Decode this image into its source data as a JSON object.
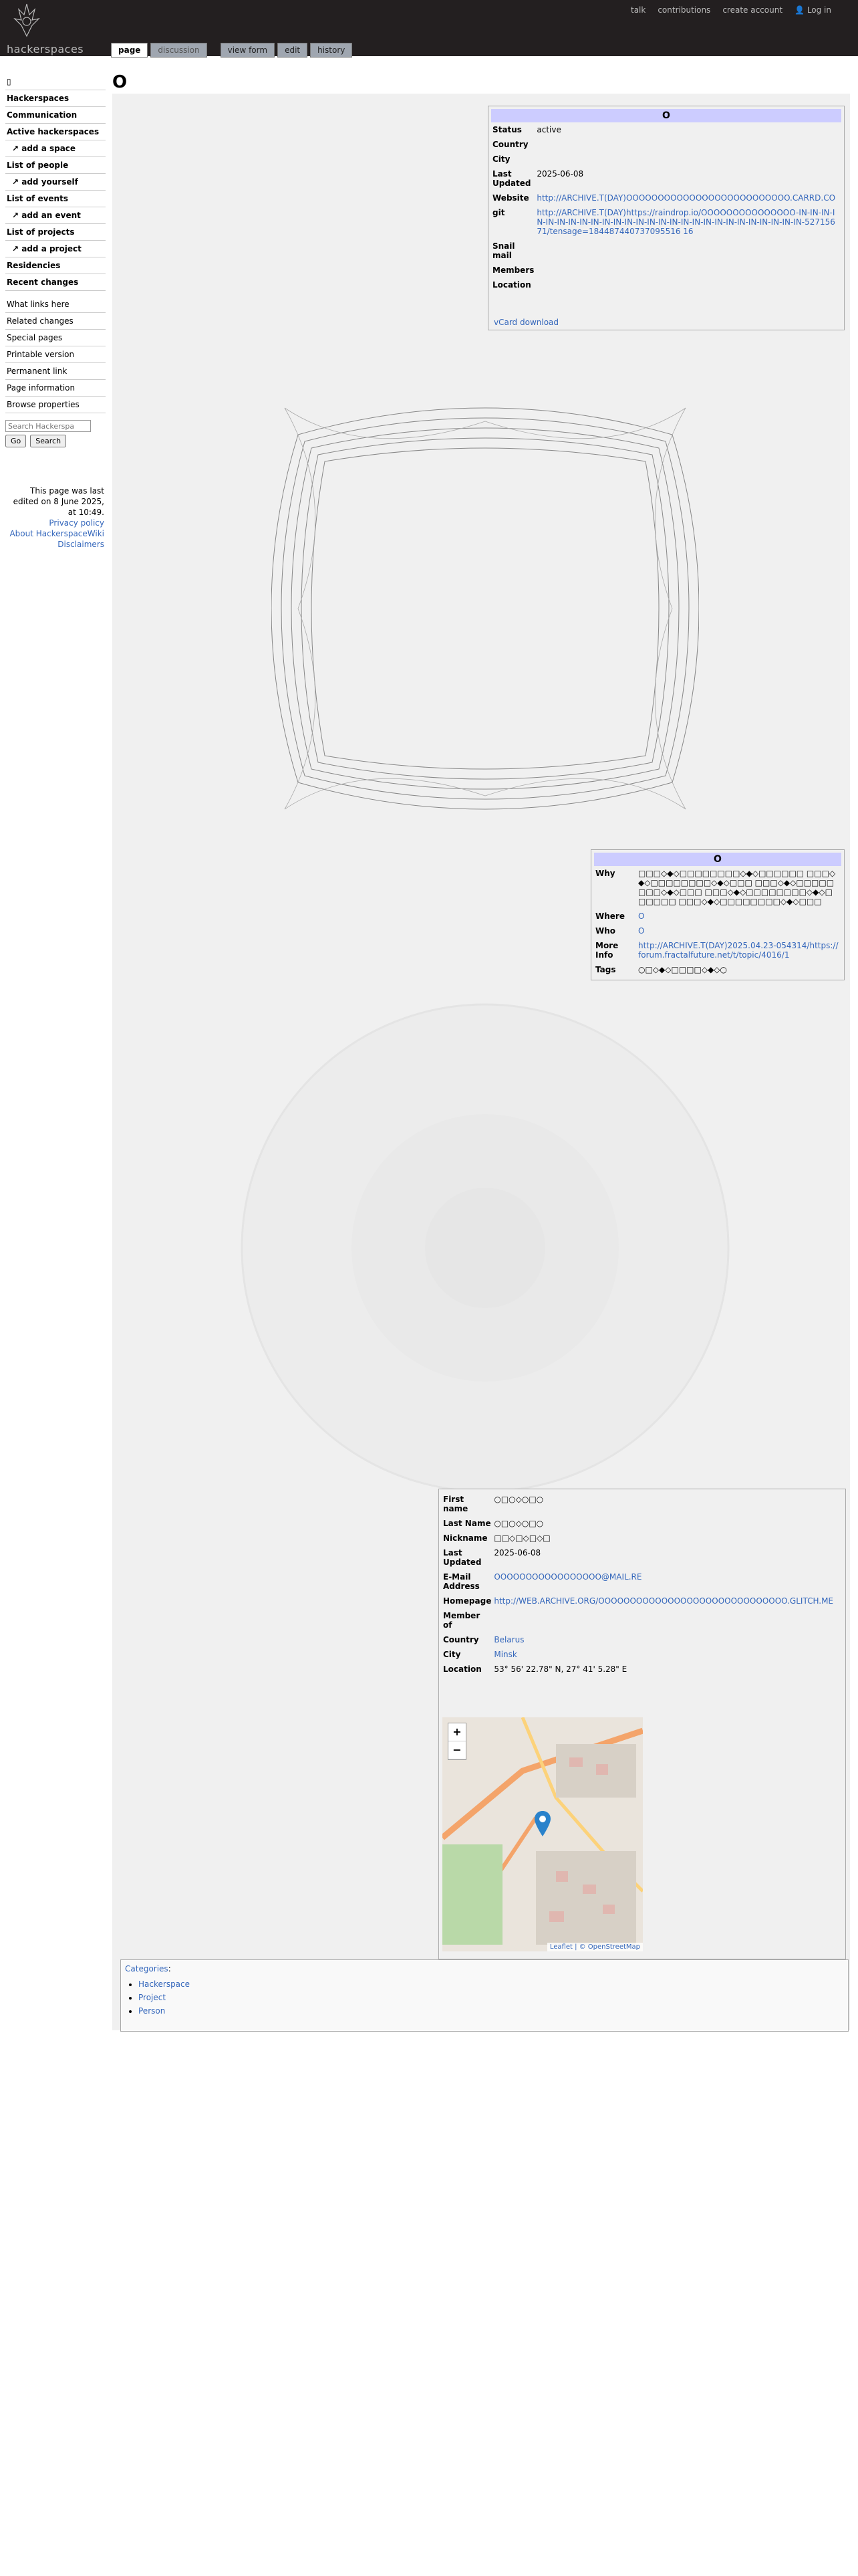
{
  "topbar": {
    "logo_text": "hackerspaces",
    "user_links": [
      "talk",
      "contributions",
      "create account",
      "Log in"
    ]
  },
  "tabs": [
    "page",
    "discussion",
    "view form",
    "edit",
    "history"
  ],
  "sidebar": {
    "icon_text": "▯",
    "items": [
      {
        "label": "Hackerspaces",
        "kind": "b"
      },
      {
        "label": "Communication",
        "kind": "b"
      },
      {
        "label": "Active hackerspaces",
        "kind": "b"
      },
      {
        "label": "↗ add a space",
        "kind": "sub"
      },
      {
        "label": "List of people",
        "kind": "b"
      },
      {
        "label": "↗ add yourself",
        "kind": "sub"
      },
      {
        "label": "List of events",
        "kind": "b"
      },
      {
        "label": "↗ add an event",
        "kind": "sub"
      },
      {
        "label": "List of projects",
        "kind": "b"
      },
      {
        "label": "↗ add a project",
        "kind": "sub"
      },
      {
        "label": "Residencies",
        "kind": "b"
      },
      {
        "label": "Recent changes",
        "kind": "b"
      }
    ],
    "tools": [
      "What links here",
      "Related changes",
      "Special pages",
      "Printable version",
      "Permanent link",
      "Page information",
      "Browse properties"
    ],
    "search_placeholder": "Search Hackerspa",
    "go_label": "Go",
    "search_label": "Search"
  },
  "footer": {
    "edited": "This page was last edited on 8 June 2025, at 10:49.",
    "links": [
      "Privacy policy",
      "About HackerspaceWiki",
      "Disclaimers"
    ]
  },
  "page_title": "O",
  "space_box": {
    "title": "O",
    "rows": [
      {
        "k": "Status",
        "v": "active"
      },
      {
        "k": "Country",
        "v": ""
      },
      {
        "k": "City",
        "v": ""
      },
      {
        "k": "Last Updated",
        "v": "2025-06-08"
      },
      {
        "k": "Website",
        "v": "http://ARCHIVE.T(DAY)OOOOOOOOOOOOOOOOOOOOOOOOOO.CARRD.CO"
      },
      {
        "k": "git",
        "v": "http://ARCHIVE.T(DAY)https://raindrop.io/OOOOOOOOOOOOOOO-IN-IN-IN-IN-IN-IN-IN-IN-IN-IN-IN-IN-IN-IN-IN-IN-IN-IN-IN-IN-IN-IN-IN-IN-IN-IN-IN-52715671/tensage=184487440737095516 16"
      },
      {
        "k": "Snail mail",
        "v": ""
      },
      {
        "k": "Members",
        "v": ""
      },
      {
        "k": "Location",
        "v": ""
      }
    ],
    "vcard": "vCard download"
  },
  "project_box": {
    "title": "O",
    "rows": [
      {
        "k": "Why",
        "v": "□□□◇◆◇□□□□□□□□◇◆◇□□□□□□ □□□◇◆◇□□□□□□□□◇◆◇□□□ □□□◇◆◇□□□□□□□□◇◆◇□□□ □□□◇◆◇□□□□□□□□◇◆◇□□□□□□ □□□◇◆◇□□□□□□□□◇◆◇□□□"
      },
      {
        "k": "Where",
        "v": "O"
      },
      {
        "k": "Who",
        "v": "O"
      },
      {
        "k": "More Info",
        "v": "http://ARCHIVE.T(DAY)2025.04.23-054314/https://forum.fractalfuture.net/t/topic/4016/1"
      },
      {
        "k": "Tags",
        "v": "○□◇◆◇□□□□◇◆◇○"
      }
    ]
  },
  "person_box": {
    "rows": [
      {
        "k": "First name",
        "v": "○□○◇○□○"
      },
      {
        "k": "Last Name",
        "v": "○□○◇○□○"
      },
      {
        "k": "Nickname",
        "v": "□□◇□◇□◇□"
      },
      {
        "k": "Last Updated",
        "v": "2025-06-08"
      },
      {
        "k": "E-Mail Address",
        "v": "OOOOOOOOOOOOOOOOO@MAIL.RE"
      },
      {
        "k": "Homepage",
        "v": "http://WEB.ARCHIVE.ORG/OOOOOOOOOOOOOOOOOOOOOOOOOOOOOO.GLITCH.ME"
      },
      {
        "k": "Member of",
        "v": ""
      },
      {
        "k": "Country",
        "v": "Belarus"
      },
      {
        "k": "City",
        "v": "Minsk"
      },
      {
        "k": "Location",
        "v": "53° 56' 22.78\" N, 27° 41' 5.28\" E"
      }
    ],
    "map_attribution": "Leaflet | © OpenStreetMap",
    "zoom_in": "+",
    "zoom_out": "−"
  },
  "categories": {
    "label": "Categories",
    "items": [
      "Hackerspace",
      "Project",
      "Person"
    ]
  }
}
